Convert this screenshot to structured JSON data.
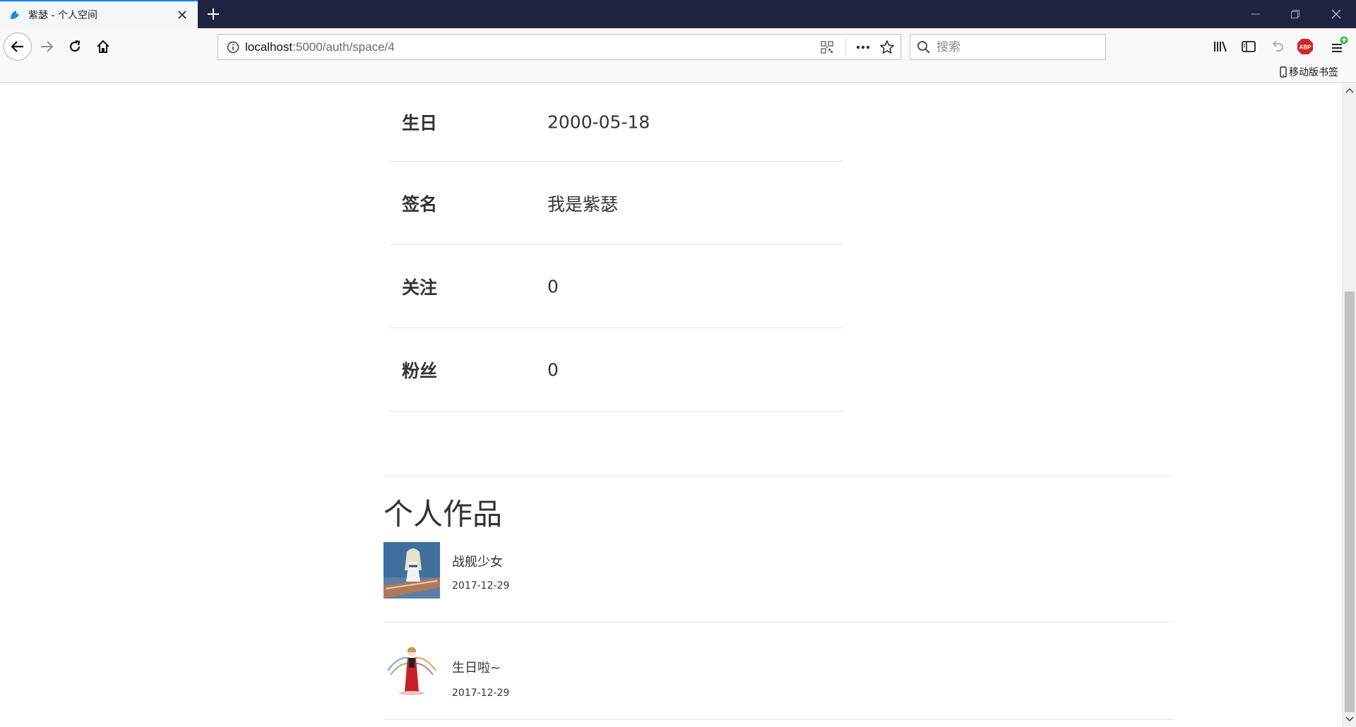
{
  "browser": {
    "tab_title": "紫瑟 - 个人空间",
    "url_host": "localhost",
    "url_path": ":5000/auth/space/4",
    "search_placeholder": "搜索",
    "mobile_bookmarks": "移动版书签",
    "addon_badge": "ABP"
  },
  "profile": {
    "rows": [
      {
        "label": "生日",
        "value": "2000-05-18"
      },
      {
        "label": "签名",
        "value": "我是紫瑟"
      },
      {
        "label": "关注",
        "value": "0"
      },
      {
        "label": "粉丝",
        "value": "0"
      }
    ]
  },
  "works": {
    "title": "个人作品",
    "items": [
      {
        "title": "战舰少女",
        "date": "2017-12-29",
        "thumb": "anime-warship-girl-thumbnail"
      },
      {
        "title": "生日啦~",
        "date": "2017-12-29",
        "thumb": "anime-red-dress-girl-thumbnail"
      }
    ]
  },
  "colors": {
    "titlebar": "#202340",
    "tab_accent": "#0a84ff",
    "abp_red": "#d1272b"
  }
}
